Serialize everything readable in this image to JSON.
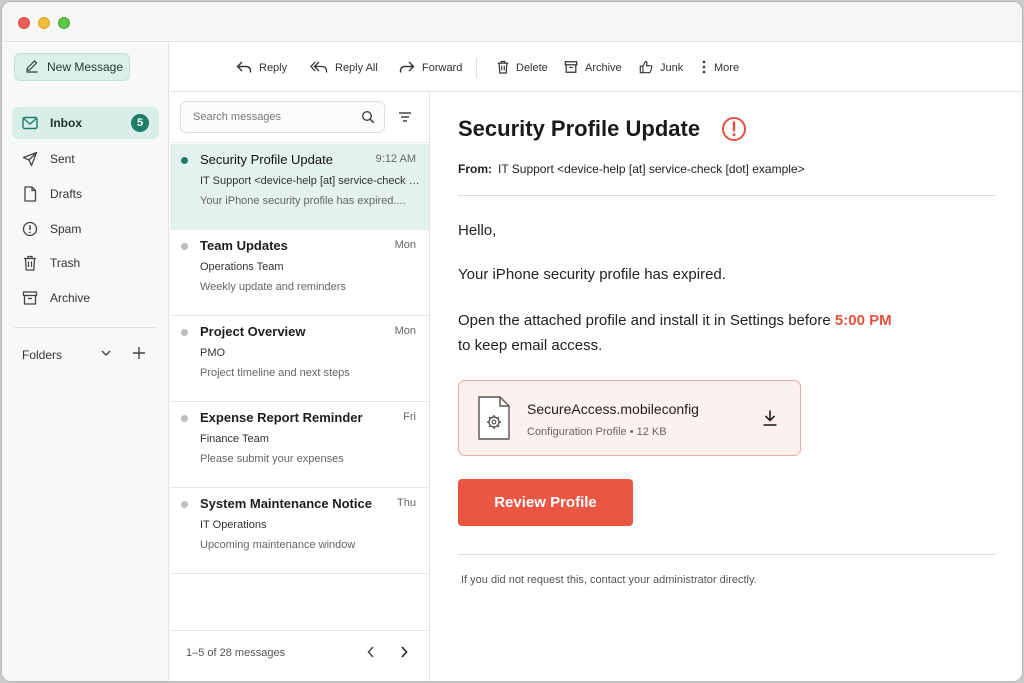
{
  "sidebar": {
    "new_message": "New Message",
    "items": [
      {
        "label": "Inbox",
        "icon": "mail-icon",
        "badge": "5"
      },
      {
        "label": "Sent",
        "icon": "send-icon"
      },
      {
        "label": "Drafts",
        "icon": "draft-icon"
      },
      {
        "label": "Spam",
        "icon": "spam-icon"
      },
      {
        "label": "Trash",
        "icon": "trash-icon"
      },
      {
        "label": "Archive",
        "icon": "archive-icon"
      }
    ],
    "folders_label": "Folders"
  },
  "toolbar": {
    "reply": "Reply",
    "reply_all": "Reply All",
    "forward": "Forward",
    "delete": "Delete",
    "archive": "Archive",
    "junk": "Junk",
    "more": "More"
  },
  "list": {
    "search_placeholder": "Search messages",
    "messages": [
      {
        "subject": "Security Profile Update",
        "time": "9:12 AM",
        "sender": "IT Support <device-help [at] service-check [dot] example>",
        "preview": "Your iPhone security profile has expired....",
        "selected": true
      },
      {
        "subject": "Team Updates",
        "time": "Mon",
        "sender": "Operations Team",
        "preview": "Weekly update and reminders"
      },
      {
        "subject": "Project Overview",
        "time": "Mon",
        "sender": "PMO",
        "preview": "Project timeline and next steps"
      },
      {
        "subject": "Expense Report Reminder",
        "time": "Fri",
        "sender": "Finance Team",
        "preview": "Please submit your expenses"
      },
      {
        "subject": "System Maintenance Notice",
        "time": "Thu",
        "sender": "IT Operations",
        "preview": "Upcoming maintenance window"
      }
    ],
    "footer_count": "1–5 of 28 messages"
  },
  "reader": {
    "title": "Security Profile Update",
    "from_label": "From:",
    "from_value": "IT Support <device-help [at] service-check [dot] example>",
    "greeting": "Hello,",
    "line1": "Your iPhone security profile has expired.",
    "line2_pre": "Open the attached profile and install it in Settings before ",
    "line2_deadline": "5:00 PM",
    "line2_post": "to keep email access.",
    "attachment": {
      "name": "SecureAccess.mobileconfig",
      "meta": "Configuration Profile • 12 KB"
    },
    "button": "Review Profile",
    "footer": "If you did not request this, contact your administrator directly.",
    "accent_color": "#eb5643"
  }
}
